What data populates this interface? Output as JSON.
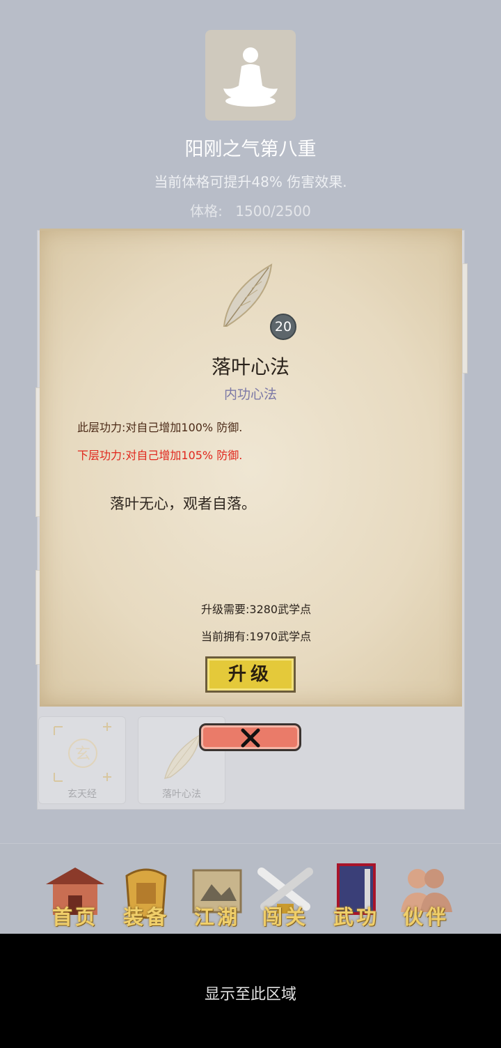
{
  "header": {
    "realm_title": "阳刚之气第八重",
    "realm_desc": "当前体格可提升48% 伤害效果.",
    "phys_label": "体格:",
    "phys_value": "1500/2500"
  },
  "skill": {
    "level": "20",
    "name": "落叶心法",
    "type": "内功心法",
    "current_effect": "此层功力:对自己增加100% 防御.",
    "next_effect": "下层功力:对自己增加105% 防御.",
    "motto": "落叶无心，观者自落。",
    "upgrade_need": "升级需要:3280武学点",
    "current_own": "当前拥有:1970武学点",
    "upgrade_label": "升级"
  },
  "slots": [
    {
      "label": "玄天经"
    },
    {
      "label": "落叶心法"
    }
  ],
  "nav": [
    {
      "label": "首页",
      "icon": "house-icon"
    },
    {
      "label": "装备",
      "icon": "armor-icon"
    },
    {
      "label": "江湖",
      "icon": "map-scroll-icon"
    },
    {
      "label": "闯关",
      "icon": "swords-icon"
    },
    {
      "label": "武功",
      "icon": "book-icon"
    },
    {
      "label": "伙伴",
      "icon": "partners-icon"
    }
  ],
  "footer": {
    "text": "显示至此区域"
  },
  "colors": {
    "next_effect": "#e0261c",
    "upgrade_button": "#e4c93a",
    "close_button": "#ea7b69"
  }
}
